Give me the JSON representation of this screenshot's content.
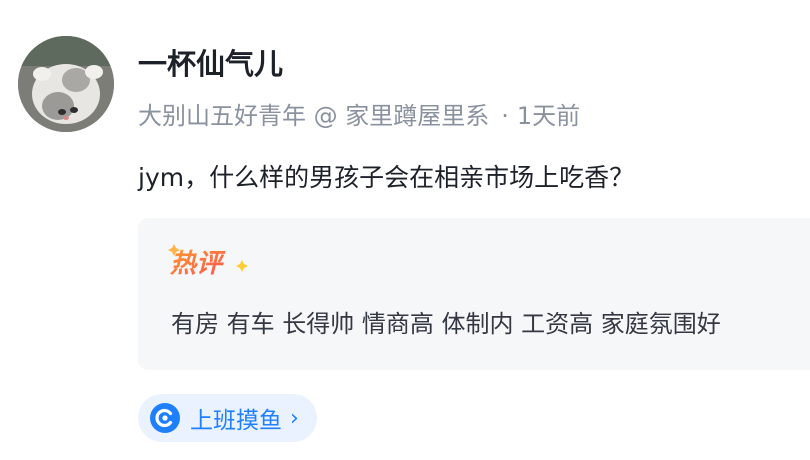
{
  "post": {
    "author": {
      "name": "一杯仙气儿",
      "title": "大别山五好青年 @ 家里蹲屋里系",
      "avatar_icon": "cat-avatar"
    },
    "meta_separator": "·",
    "time": "1天前",
    "content": "jym，什么样的男孩子会在相亲市场上吃香？",
    "hot_comment": {
      "tag_label": "热评",
      "text": "有房 有车 长得帅 情商高 体制内 工资高 家庭氛围好"
    },
    "topic": {
      "label": "上班摸鱼",
      "icon": "topic-c-icon",
      "chevron": "›"
    }
  },
  "colors": {
    "accent": "#1e80ff",
    "hot_tag_start": "#ff9a2e",
    "hot_tag_end": "#ff4d4f",
    "meta": "#8a919f"
  }
}
